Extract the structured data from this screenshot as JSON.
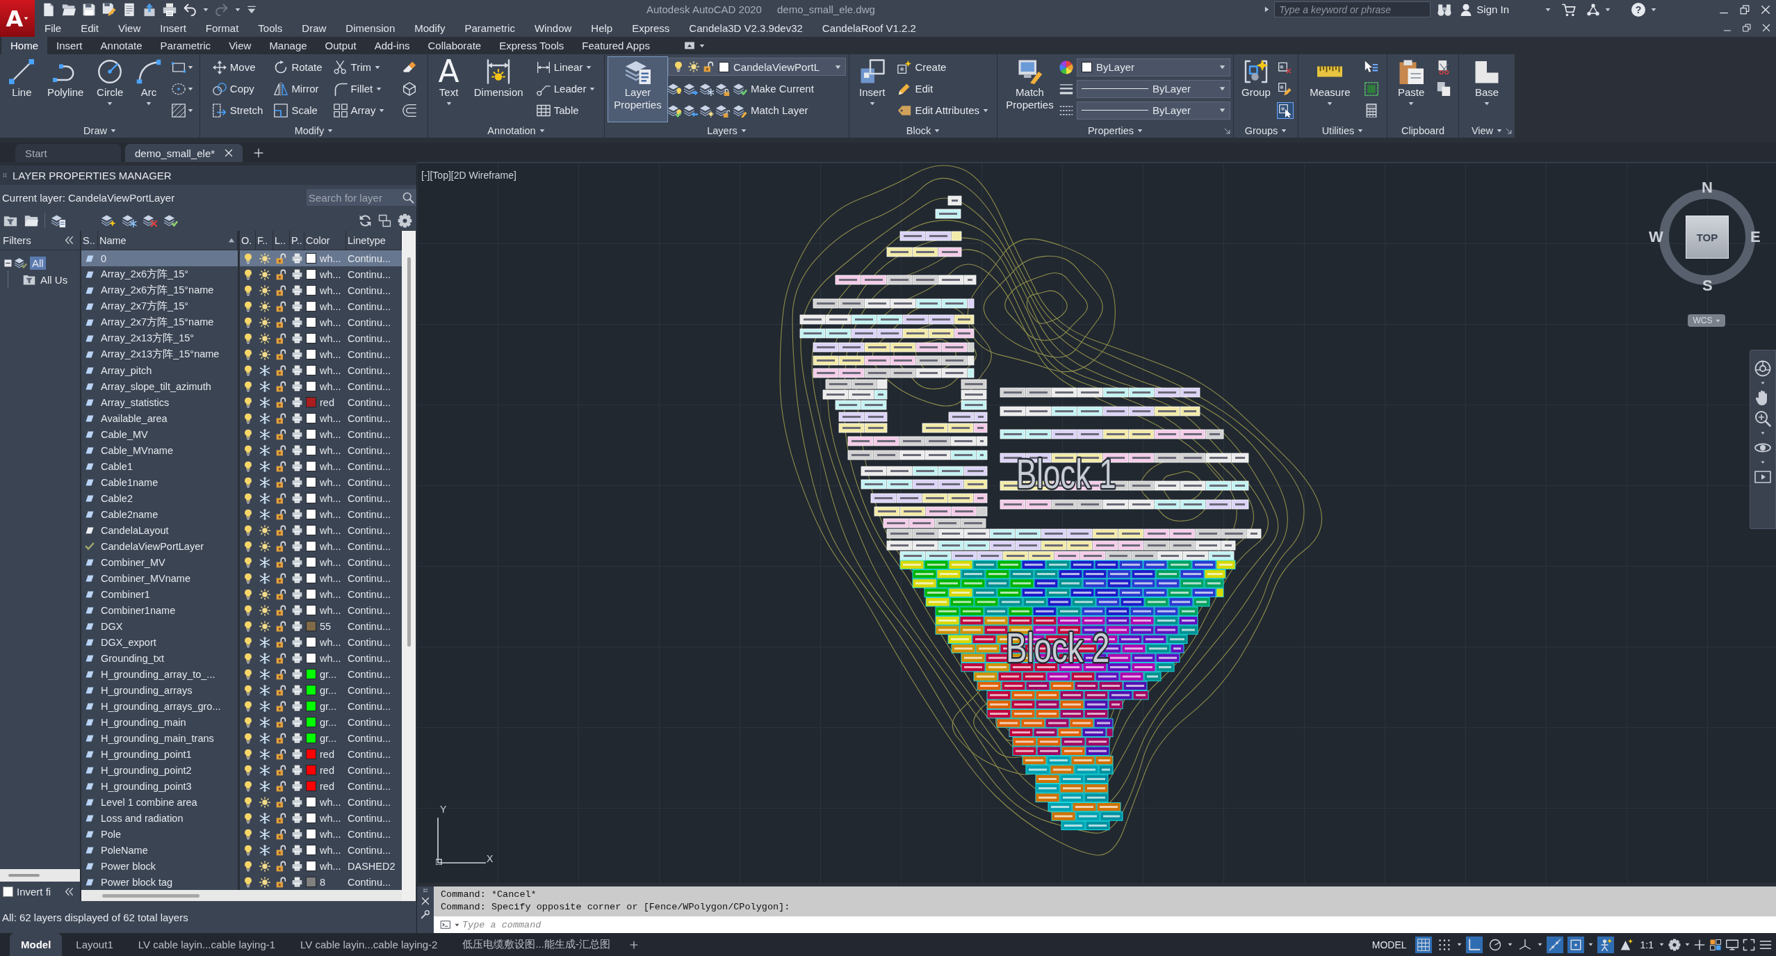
{
  "title_bar": {
    "logo": "A",
    "app": "Autodesk AutoCAD 2020",
    "file": "demo_small_ele.dwg",
    "undo": {
      "disabled": false
    },
    "redo": {
      "disabled": true
    },
    "search": {
      "placeholder": "Type a keyword or phrase"
    },
    "sign_in": "Sign In",
    "help": "?"
  },
  "menu_bar": [
    "File",
    "Edit",
    "View",
    "Insert",
    "Format",
    "Tools",
    "Draw",
    "Dimension",
    "Modify",
    "Parametric",
    "Window",
    "Help",
    "Express",
    "Candela3D V2.3.9dev32",
    "CandelaRoof V1.2.2"
  ],
  "ribbon_tabs": [
    {
      "label": "Home",
      "selected": true
    },
    {
      "label": "Insert",
      "selected": false
    },
    {
      "label": "Annotate",
      "selected": false
    },
    {
      "label": "Parametric",
      "selected": false
    },
    {
      "label": "View",
      "selected": false
    },
    {
      "label": "Manage",
      "selected": false
    },
    {
      "label": "Output",
      "selected": false
    },
    {
      "label": "Add-ins",
      "selected": false
    },
    {
      "label": "Collaborate",
      "selected": false
    },
    {
      "label": "Express Tools",
      "selected": false
    },
    {
      "label": "Featured Apps",
      "selected": false
    }
  ],
  "ribbon_panels": [
    {
      "title": "Draw",
      "expandable": true,
      "launcher": false,
      "large": [
        {
          "label": "Line",
          "caret": false,
          "active": false
        },
        {
          "label": "Polyline",
          "caret": false,
          "active": false
        },
        {
          "label": "Circle",
          "caret": true,
          "active": false
        },
        {
          "label": "Arc",
          "caret": true,
          "active": false
        }
      ]
    },
    {
      "title": "Modify",
      "expandable": true,
      "launcher": false,
      "small": [
        {
          "label": "Move",
          "caret": false
        },
        {
          "label": "Copy",
          "caret": false
        },
        {
          "label": "Stretch",
          "caret": false
        },
        {
          "label": "Rotate",
          "caret": false
        },
        {
          "label": "Mirror",
          "caret": false
        },
        {
          "label": "Scale",
          "caret": false
        },
        {
          "label": "Trim",
          "caret": true
        },
        {
          "label": "Fillet",
          "caret": true
        },
        {
          "label": "Array",
          "caret": true
        }
      ]
    },
    {
      "title": "Annotation",
      "expandable": true,
      "launcher": false,
      "large": [
        {
          "label": "Text",
          "glyph": "A",
          "caret": true,
          "active": false
        },
        {
          "label": "Dimension",
          "caret": false,
          "active": false
        }
      ],
      "small": [
        {
          "label": "Linear",
          "caret": true
        },
        {
          "label": "Leader",
          "caret": true
        },
        {
          "label": "Table",
          "caret": false
        }
      ]
    },
    {
      "title": "Layers",
      "expandable": true,
      "launcher": false,
      "large": [
        {
          "label": "Layer Properties",
          "caret": false,
          "active": true
        }
      ],
      "dropdowns": [
        {
          "kind": "layer",
          "value": "CandelaViewPortL",
          "color": "#ffffff",
          "on": true,
          "frozen": false,
          "locked": false
        }
      ],
      "small": [
        {
          "label": "Make Current",
          "caret": false
        },
        {
          "label": "Match Layer",
          "caret": false
        }
      ]
    },
    {
      "title": "Block",
      "expandable": true,
      "launcher": false,
      "large": [
        {
          "label": "Insert",
          "caret": true,
          "active": false
        }
      ],
      "small": [
        {
          "label": "Create",
          "caret": false
        },
        {
          "label": "Edit",
          "caret": false
        },
        {
          "label": "Edit Attributes",
          "caret": true
        }
      ]
    },
    {
      "title": "Properties",
      "expandable": true,
      "launcher": true,
      "large": [
        {
          "label": "Match Properties",
          "caret": false,
          "active": false
        }
      ],
      "dropdowns": [
        {
          "kind": "color",
          "value": "ByLayer",
          "color": "#ffffff"
        },
        {
          "kind": "lineweight",
          "value": "ByLayer"
        },
        {
          "kind": "linetype",
          "value": "ByLayer"
        }
      ]
    },
    {
      "title": "Groups",
      "expandable": true,
      "launcher": false,
      "large": [
        {
          "label": "Group",
          "caret": false,
          "active": false
        }
      ],
      "selection_toggle": {
        "on": true
      }
    },
    {
      "title": "Utilities",
      "expandable": true,
      "launcher": false,
      "large": [
        {
          "label": "Measure",
          "caret": true,
          "active": false
        }
      ]
    },
    {
      "title": "Clipboard",
      "expandable": false,
      "launcher": false,
      "large": [
        {
          "label": "Paste",
          "caret": true,
          "active": false
        }
      ]
    },
    {
      "title": "View",
      "expandable": true,
      "launcher": true,
      "large": [
        {
          "label": "Base",
          "caret": true,
          "active": false
        }
      ]
    }
  ],
  "file_tabs": [
    {
      "label": "Start",
      "selected": false,
      "closable": false
    },
    {
      "label": "demo_small_ele*",
      "selected": true,
      "closable": true
    }
  ],
  "layer_manager": {
    "title": "LAYER PROPERTIES MANAGER",
    "current_layer": "Current layer: CandelaViewPortLayer",
    "search": {
      "placeholder": "Search for layer"
    },
    "filters_title": "Filters",
    "filters": [
      {
        "label": "All",
        "selected": true,
        "expanded": true,
        "children": [
          {
            "label": "All Us",
            "selected": false
          }
        ]
      }
    ],
    "invert_filter": {
      "label": "Invert fi",
      "checked": false
    },
    "columns": [
      "S..",
      "Name",
      "O.",
      "F..",
      "L..",
      "P..",
      "Color",
      "Linetype"
    ],
    "layers": [
      {
        "name": "0",
        "kind": "in_use",
        "selected": true,
        "on": true,
        "frozen": false,
        "locked": false,
        "plot": true,
        "color": "#ffffff",
        "color_name": "wh...",
        "linetype": "Continu..."
      },
      {
        "name": "Array_2x6方阵_15°",
        "kind": "in_use",
        "selected": false,
        "on": true,
        "frozen": false,
        "locked": false,
        "plot": true,
        "color": "#ffffff",
        "color_name": "wh...",
        "linetype": "Continu..."
      },
      {
        "name": "Array_2x6方阵_15°name",
        "kind": "in_use",
        "selected": false,
        "on": true,
        "frozen": false,
        "locked": false,
        "plot": true,
        "color": "#ffffff",
        "color_name": "wh...",
        "linetype": "Continu..."
      },
      {
        "name": "Array_2x7方阵_15°",
        "kind": "in_use",
        "selected": false,
        "on": true,
        "frozen": false,
        "locked": false,
        "plot": true,
        "color": "#ffffff",
        "color_name": "wh...",
        "linetype": "Continu..."
      },
      {
        "name": "Array_2x7方阵_15°name",
        "kind": "in_use",
        "selected": false,
        "on": true,
        "frozen": false,
        "locked": false,
        "plot": true,
        "color": "#ffffff",
        "color_name": "wh...",
        "linetype": "Continu..."
      },
      {
        "name": "Array_2x13方阵_15°",
        "kind": "in_use",
        "selected": false,
        "on": true,
        "frozen": false,
        "locked": false,
        "plot": true,
        "color": "#ffffff",
        "color_name": "wh...",
        "linetype": "Continu..."
      },
      {
        "name": "Array_2x13方阵_15°name",
        "kind": "in_use",
        "selected": false,
        "on": true,
        "frozen": false,
        "locked": false,
        "plot": true,
        "color": "#ffffff",
        "color_name": "wh...",
        "linetype": "Continu..."
      },
      {
        "name": "Array_pitch",
        "kind": "in_use",
        "selected": false,
        "on": true,
        "frozen": true,
        "locked": false,
        "plot": true,
        "color": "#ffffff",
        "color_name": "wh...",
        "linetype": "Continu..."
      },
      {
        "name": "Array_slope_tilt_azimuth",
        "kind": "in_use",
        "selected": false,
        "on": true,
        "frozen": true,
        "locked": false,
        "plot": true,
        "color": "#ffffff",
        "color_name": "wh...",
        "linetype": "Continu..."
      },
      {
        "name": "Array_statistics",
        "kind": "in_use",
        "selected": false,
        "on": true,
        "frozen": true,
        "locked": false,
        "plot": true,
        "color": "#aa1e1e",
        "color_name": "red",
        "linetype": "Continu..."
      },
      {
        "name": "Available_area",
        "kind": "in_use",
        "selected": false,
        "on": true,
        "frozen": true,
        "locked": false,
        "plot": true,
        "color": "#ffffff",
        "color_name": "wh...",
        "linetype": "Continu..."
      },
      {
        "name": "Cable_MV",
        "kind": "in_use",
        "selected": false,
        "on": true,
        "frozen": true,
        "locked": false,
        "plot": true,
        "color": "#ffffff",
        "color_name": "wh...",
        "linetype": "Continu..."
      },
      {
        "name": "Cable_MVname",
        "kind": "in_use",
        "selected": false,
        "on": true,
        "frozen": true,
        "locked": false,
        "plot": true,
        "color": "#ffffff",
        "color_name": "wh...",
        "linetype": "Continu..."
      },
      {
        "name": "Cable1",
        "kind": "in_use",
        "selected": false,
        "on": true,
        "frozen": true,
        "locked": false,
        "plot": true,
        "color": "#ffffff",
        "color_name": "wh...",
        "linetype": "Continu..."
      },
      {
        "name": "Cable1name",
        "kind": "in_use",
        "selected": false,
        "on": true,
        "frozen": true,
        "locked": false,
        "plot": true,
        "color": "#ffffff",
        "color_name": "wh...",
        "linetype": "Continu..."
      },
      {
        "name": "Cable2",
        "kind": "in_use",
        "selected": false,
        "on": true,
        "frozen": true,
        "locked": false,
        "plot": true,
        "color": "#ffffff",
        "color_name": "wh...",
        "linetype": "Continu..."
      },
      {
        "name": "Cable2name",
        "kind": "in_use",
        "selected": false,
        "on": true,
        "frozen": true,
        "locked": false,
        "plot": true,
        "color": "#ffffff",
        "color_name": "wh...",
        "linetype": "Continu..."
      },
      {
        "name": "CandelaLayout",
        "kind": "unused",
        "selected": false,
        "on": true,
        "frozen": false,
        "locked": false,
        "plot": true,
        "color": "#ffffff",
        "color_name": "wh...",
        "linetype": "Continu..."
      },
      {
        "name": "CandelaViewPortLayer",
        "kind": "current",
        "selected": false,
        "on": true,
        "frozen": false,
        "locked": false,
        "plot": true,
        "color": "#ffffff",
        "color_name": "wh...",
        "linetype": "Continu..."
      },
      {
        "name": "Combiner_MV",
        "kind": "in_use",
        "selected": false,
        "on": true,
        "frozen": true,
        "locked": false,
        "plot": true,
        "color": "#ffffff",
        "color_name": "wh...",
        "linetype": "Continu..."
      },
      {
        "name": "Combiner_MVname",
        "kind": "in_use",
        "selected": false,
        "on": true,
        "frozen": true,
        "locked": false,
        "plot": true,
        "color": "#ffffff",
        "color_name": "wh...",
        "linetype": "Continu..."
      },
      {
        "name": "Combiner1",
        "kind": "in_use",
        "selected": false,
        "on": true,
        "frozen": false,
        "locked": false,
        "plot": true,
        "color": "#ffffff",
        "color_name": "wh...",
        "linetype": "Continu..."
      },
      {
        "name": "Combiner1name",
        "kind": "in_use",
        "selected": false,
        "on": true,
        "frozen": false,
        "locked": false,
        "plot": true,
        "color": "#ffffff",
        "color_name": "wh...",
        "linetype": "Continu..."
      },
      {
        "name": "DGX",
        "kind": "in_use",
        "selected": false,
        "on": true,
        "frozen": false,
        "locked": false,
        "plot": true,
        "color": "#806a48",
        "color_name": "55",
        "linetype": "Continu..."
      },
      {
        "name": "DGX_export",
        "kind": "in_use",
        "selected": false,
        "on": true,
        "frozen": true,
        "locked": false,
        "plot": true,
        "color": "#ffffff",
        "color_name": "wh...",
        "linetype": "Continu..."
      },
      {
        "name": "Grounding_txt",
        "kind": "in_use",
        "selected": false,
        "on": true,
        "frozen": true,
        "locked": false,
        "plot": true,
        "color": "#ffffff",
        "color_name": "wh...",
        "linetype": "Continu..."
      },
      {
        "name": "H_grounding_array_to_...",
        "kind": "in_use",
        "selected": false,
        "on": true,
        "frozen": true,
        "locked": false,
        "plot": true,
        "color": "#00ff00",
        "color_name": "gr...",
        "linetype": "Continu..."
      },
      {
        "name": "H_grounding_arrays",
        "kind": "in_use",
        "selected": false,
        "on": true,
        "frozen": true,
        "locked": false,
        "plot": true,
        "color": "#00ff00",
        "color_name": "gr...",
        "linetype": "Continu..."
      },
      {
        "name": "H_grounding_arrays_gro...",
        "kind": "in_use",
        "selected": false,
        "on": true,
        "frozen": true,
        "locked": false,
        "plot": true,
        "color": "#00ff00",
        "color_name": "gr...",
        "linetype": "Continu..."
      },
      {
        "name": "H_grounding_main",
        "kind": "in_use",
        "selected": false,
        "on": true,
        "frozen": true,
        "locked": false,
        "plot": true,
        "color": "#00ff00",
        "color_name": "gr...",
        "linetype": "Continu..."
      },
      {
        "name": "H_grounding_main_trans",
        "kind": "in_use",
        "selected": false,
        "on": true,
        "frozen": true,
        "locked": false,
        "plot": true,
        "color": "#00ff00",
        "color_name": "gr...",
        "linetype": "Continu..."
      },
      {
        "name": "H_grounding_point1",
        "kind": "in_use",
        "selected": false,
        "on": true,
        "frozen": true,
        "locked": false,
        "plot": true,
        "color": "#ff0000",
        "color_name": "red",
        "linetype": "Continu..."
      },
      {
        "name": "H_grounding_point2",
        "kind": "in_use",
        "selected": false,
        "on": true,
        "frozen": true,
        "locked": false,
        "plot": true,
        "color": "#ff0000",
        "color_name": "red",
        "linetype": "Continu..."
      },
      {
        "name": "H_grounding_point3",
        "kind": "in_use",
        "selected": false,
        "on": true,
        "frozen": true,
        "locked": false,
        "plot": true,
        "color": "#ff0000",
        "color_name": "red",
        "linetype": "Continu..."
      },
      {
        "name": "Level 1 combine area",
        "kind": "in_use",
        "selected": false,
        "on": true,
        "frozen": false,
        "locked": false,
        "plot": true,
        "color": "#ffffff",
        "color_name": "wh...",
        "linetype": "Continu..."
      },
      {
        "name": "Loss and radiation",
        "kind": "in_use",
        "selected": false,
        "on": true,
        "frozen": true,
        "locked": false,
        "plot": true,
        "color": "#ffffff",
        "color_name": "wh...",
        "linetype": "Continu..."
      },
      {
        "name": "Pole",
        "kind": "in_use",
        "selected": false,
        "on": true,
        "frozen": true,
        "locked": false,
        "plot": true,
        "color": "#ffffff",
        "color_name": "wh...",
        "linetype": "Continu..."
      },
      {
        "name": "PoleName",
        "kind": "in_use",
        "selected": false,
        "on": true,
        "frozen": true,
        "locked": false,
        "plot": true,
        "color": "#ffffff",
        "color_name": "wh...",
        "linetype": "Continu..."
      },
      {
        "name": "Power block",
        "kind": "in_use",
        "selected": false,
        "on": true,
        "frozen": false,
        "locked": false,
        "plot": true,
        "color": "#ffffff",
        "color_name": "wh...",
        "linetype": "DASHED2"
      },
      {
        "name": "Power block tag",
        "kind": "in_use",
        "selected": false,
        "on": true,
        "frozen": false,
        "locked": false,
        "plot": true,
        "color": "#808080",
        "color_name": "8",
        "linetype": "Continu..."
      }
    ],
    "summary": "All: 62 layers displayed of 62 total layers"
  },
  "viewport": {
    "controls": [
      "[-]",
      "[Top]",
      "[2D Wireframe]"
    ],
    "blocks": [
      "Block 1",
      "Block 2"
    ],
    "viewcube": {
      "top": "TOP",
      "north": "N",
      "south": "S",
      "east": "E",
      "west": "W",
      "coordinate_system": "WCS"
    },
    "ucs": {
      "x": "X",
      "y": "Y"
    }
  },
  "command_line": {
    "history": [
      "Command: *Cancel*",
      "Command: Specify opposite corner or [Fence/WPolygon/CPolygon]:"
    ],
    "placeholder": "Type a command"
  },
  "status_bar": {
    "layout_tabs": [
      {
        "label": "Model",
        "selected": true
      },
      {
        "label": "Layout1",
        "selected": false
      },
      {
        "label": "LV cable layin...cable laying-1",
        "selected": false
      },
      {
        "label": "LV cable layin...cable laying-2",
        "selected": false
      },
      {
        "label": "低压电缆敷设图...能生成-汇总图",
        "selected": false
      }
    ],
    "space": "MODEL",
    "toggles": [
      {
        "on": true
      },
      {
        "on": false
      },
      {
        "on": true
      },
      {
        "on": false
      },
      {
        "on": false
      },
      {
        "on": true
      },
      {
        "on": true
      },
      {
        "on": true
      },
      {
        "on": false
      }
    ],
    "scale": "1:1"
  }
}
